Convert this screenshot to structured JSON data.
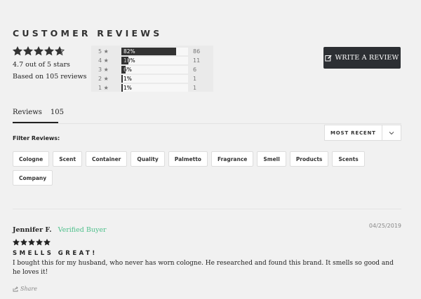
{
  "header": {
    "title": "CUSTOMER REVIEWS"
  },
  "summary": {
    "rating_value": 4.7,
    "average_text": "4.7 out of 5 stars",
    "based_on_text": "Based on 105 reviews"
  },
  "histogram": [
    {
      "label": "5 ★",
      "percent": 82,
      "pct_text": "82%",
      "count": "86"
    },
    {
      "label": "4 ★",
      "percent": 10,
      "pct_text": "10%",
      "count": "11"
    },
    {
      "label": "3 ★",
      "percent": 6,
      "pct_text": "6%",
      "count": "6"
    },
    {
      "label": "2 ★",
      "percent": 1,
      "pct_text": "1%",
      "count": "1"
    },
    {
      "label": "1 ★",
      "percent": 1,
      "pct_text": "1%",
      "count": "1"
    }
  ],
  "write_button": {
    "label": "WRITE A REVIEW"
  },
  "tabs": {
    "reviews_label": "Reviews",
    "reviews_count": "105"
  },
  "sort": {
    "label": "MOST RECENT"
  },
  "filter": {
    "label": "Filter Reviews:",
    "chips": [
      "Cologne",
      "Scent",
      "Container",
      "Quality",
      "Palmetto",
      "Fragrance",
      "Smell",
      "Products",
      "Scents",
      "Company"
    ]
  },
  "review": {
    "author": "Jennifer F.",
    "verified_label": "Verified Buyer",
    "date": "04/25/2019",
    "rating": 5,
    "title": "SMELLS GREAT!",
    "body": "I bought this for my husband, who never has worn cologne. He researched and found this brand. It smells so good and he loves it!",
    "share_label": "Share"
  },
  "colors": {
    "accent": "#2c2f33",
    "verified": "#4cbf8a",
    "background": "#f1f1f1"
  }
}
